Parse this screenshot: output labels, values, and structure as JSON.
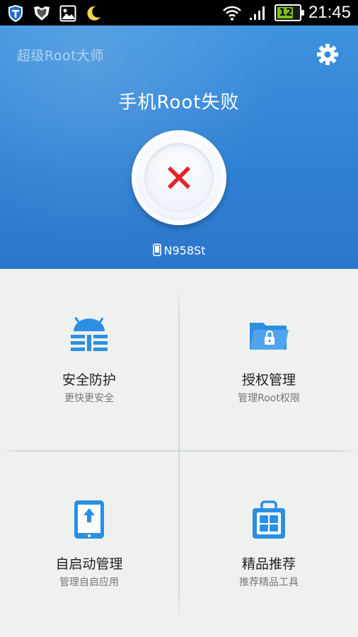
{
  "status_bar": {
    "time": "21:45",
    "battery_level": "12"
  },
  "header": {
    "app_title": "超级Root大师",
    "page_title": "手机Root失败",
    "device_model": "N958St"
  },
  "tiles": [
    {
      "title": "安全防护",
      "subtitle": "更快更安全",
      "icon": "android-shield-icon"
    },
    {
      "title": "授权管理",
      "subtitle": "管理Root权限",
      "icon": "locked-folder-icon"
    },
    {
      "title": "自启动管理",
      "subtitle": "管理自启应用",
      "icon": "tablet-upload-icon"
    },
    {
      "title": "精品推荐",
      "subtitle": "推荐精品工具",
      "icon": "app-store-bag-icon"
    }
  ],
  "colors": {
    "accent_blue": "#2f80d3",
    "icon_blue": "#2b8fe3",
    "error_red": "#e3242b",
    "battery_green": "#7ec21d"
  }
}
